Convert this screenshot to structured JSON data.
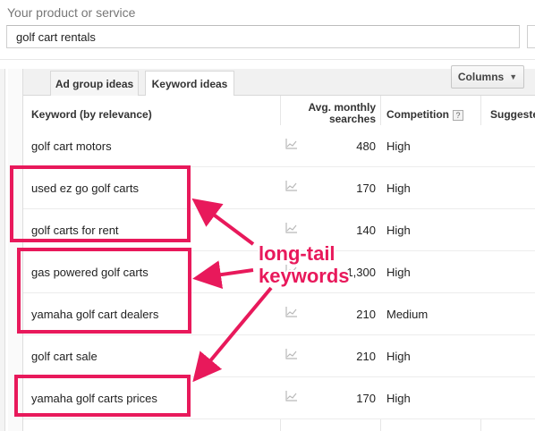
{
  "service": {
    "label": "Your product or service",
    "value": "golf cart rentals"
  },
  "tabs": [
    {
      "label": "Ad group ideas",
      "selected": false
    },
    {
      "label": "Keyword ideas",
      "selected": true
    }
  ],
  "columns_button": {
    "label": "Columns",
    "caret": "▼"
  },
  "table": {
    "headers": {
      "keyword": "Keyword (by relevance)",
      "avg_line1": "Avg. monthly",
      "avg_line2": "searches",
      "competition": "Competition",
      "suggested": "Suggeste",
      "help": "?"
    },
    "rows": [
      {
        "keyword": "golf cart motors",
        "searches": "480",
        "competition": "High"
      },
      {
        "keyword": "used ez go golf carts",
        "searches": "170",
        "competition": "High"
      },
      {
        "keyword": "golf carts for rent",
        "searches": "140",
        "competition": "High"
      },
      {
        "keyword": "gas powered golf carts",
        "searches": "1,300",
        "competition": "High"
      },
      {
        "keyword": "yamaha golf cart dealers",
        "searches": "210",
        "competition": "Medium"
      },
      {
        "keyword": "golf cart sale",
        "searches": "210",
        "competition": "High"
      },
      {
        "keyword": "yamaha golf carts prices",
        "searches": "170",
        "competition": "High"
      }
    ]
  },
  "annotation": {
    "line1": "long-tail",
    "line2": "keywords",
    "color": "#e8195b"
  },
  "icons": {
    "trend": "trend-chart-icon",
    "help": "help-icon",
    "caret": "chevron-down-icon"
  }
}
